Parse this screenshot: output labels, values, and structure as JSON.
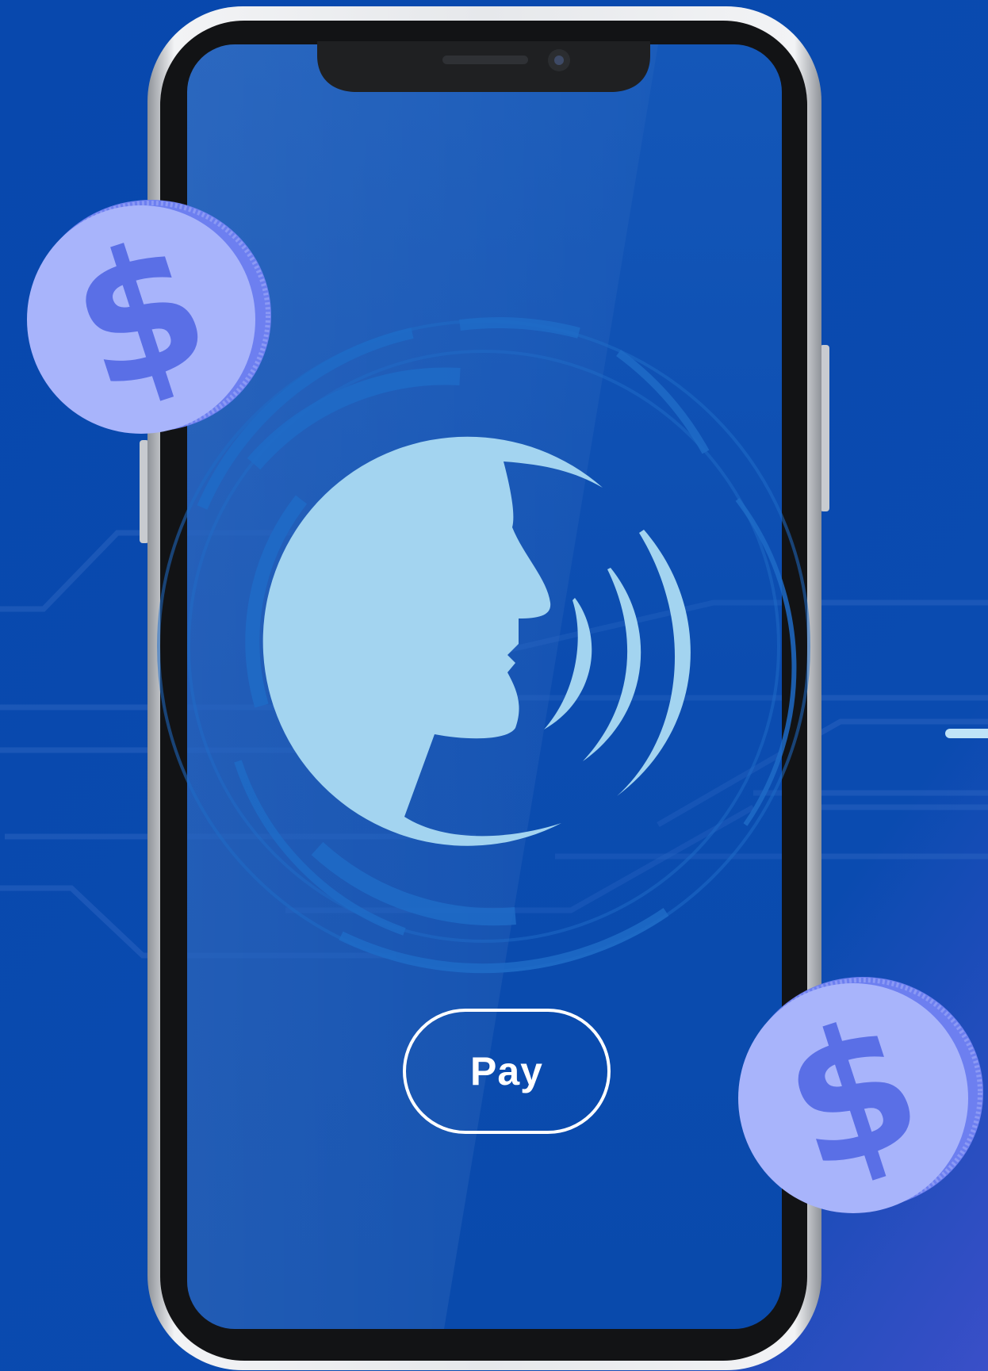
{
  "screen": {
    "pay_button_label": "Pay"
  },
  "coins": [
    {
      "symbol": "$"
    },
    {
      "symbol": "$"
    }
  ],
  "icons": {
    "voice": "speaking-head-icon",
    "coin": "dollar-coin-icon"
  },
  "colors": {
    "background": "#0a49ad",
    "screen": "#0d4fb8",
    "voice_icon": "#a3d4f0",
    "coin_face": "#a8b4fb",
    "coin_symbol": "#5a6fe6",
    "coin_edge": "#6d7ff0",
    "button_outline": "#ffffff"
  }
}
